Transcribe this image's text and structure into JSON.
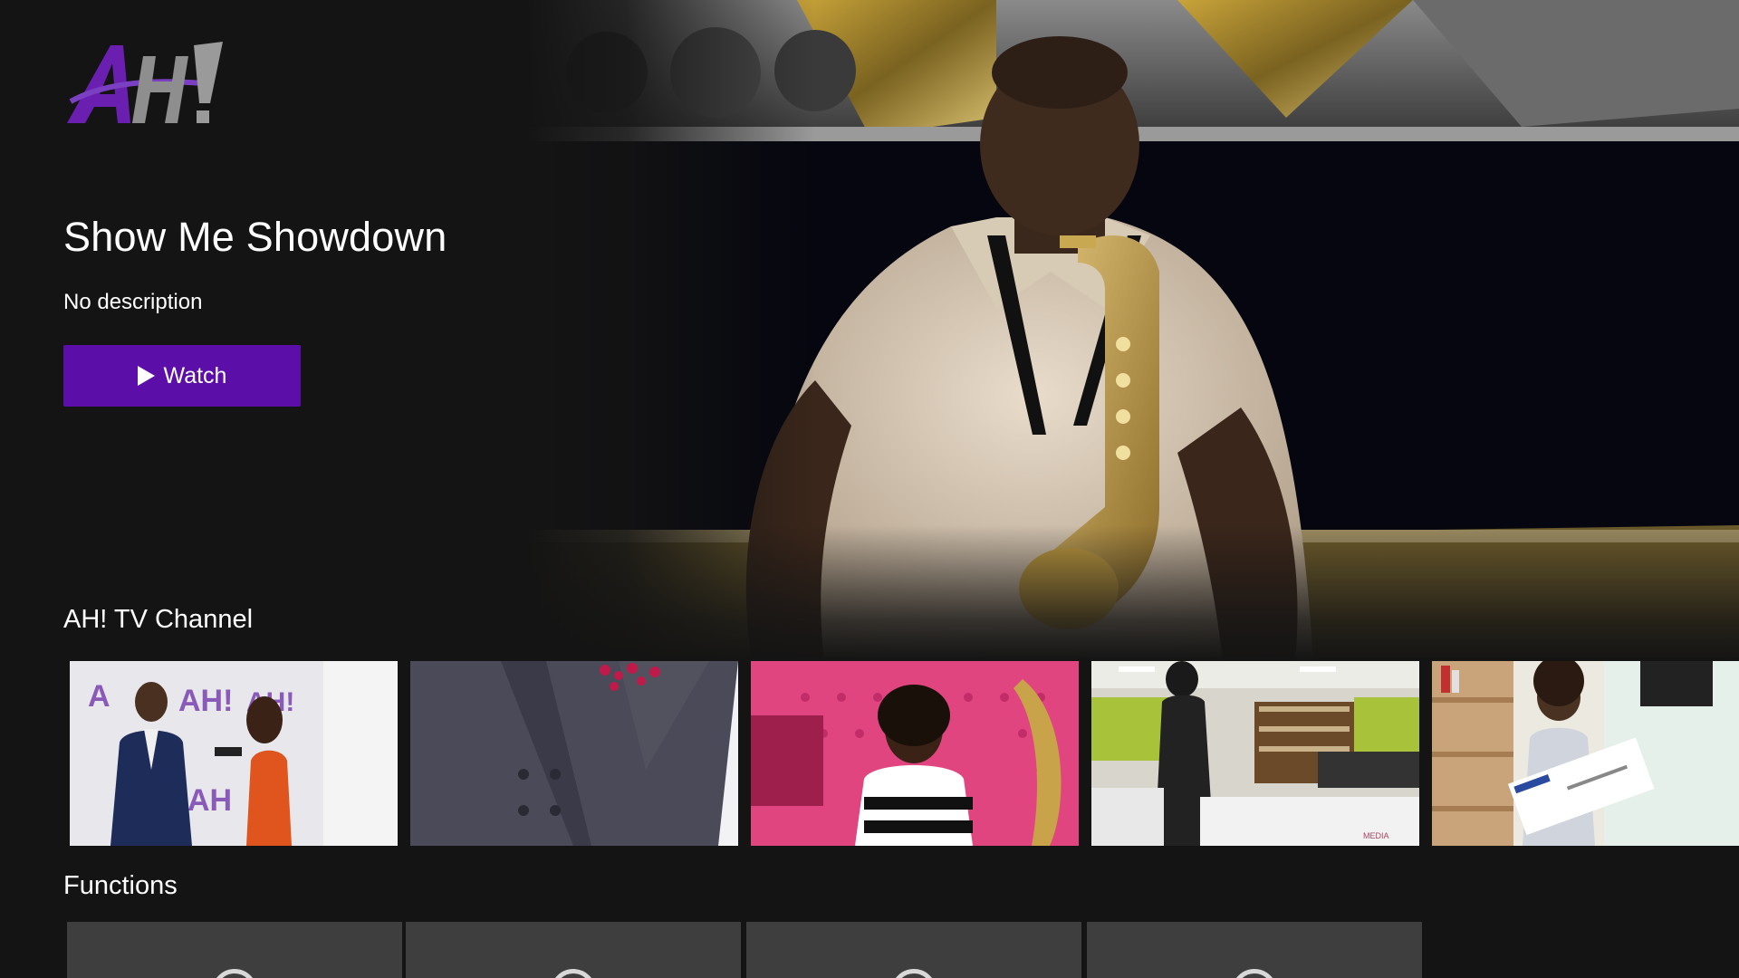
{
  "app": {
    "logo_text": "AH!",
    "logo_colors": {
      "purple": "#6a1fb0",
      "gray": "#9a9a9a"
    }
  },
  "hero": {
    "title": "Show Me Showdown",
    "description": "No description",
    "watch_label": "Watch",
    "accent_color": "#5b0fa8"
  },
  "rows": {
    "channel": {
      "title": "AH! TV Channel",
      "items": [
        {
          "name": "thumbnail-interview"
        },
        {
          "name": "thumbnail-suit"
        },
        {
          "name": "thumbnail-pink-chair"
        },
        {
          "name": "thumbnail-library"
        },
        {
          "name": "thumbnail-certificate"
        }
      ]
    },
    "functions": {
      "title": "Functions",
      "tiles": [
        "function-tile-1",
        "function-tile-2",
        "function-tile-3",
        "function-tile-4"
      ]
    }
  }
}
